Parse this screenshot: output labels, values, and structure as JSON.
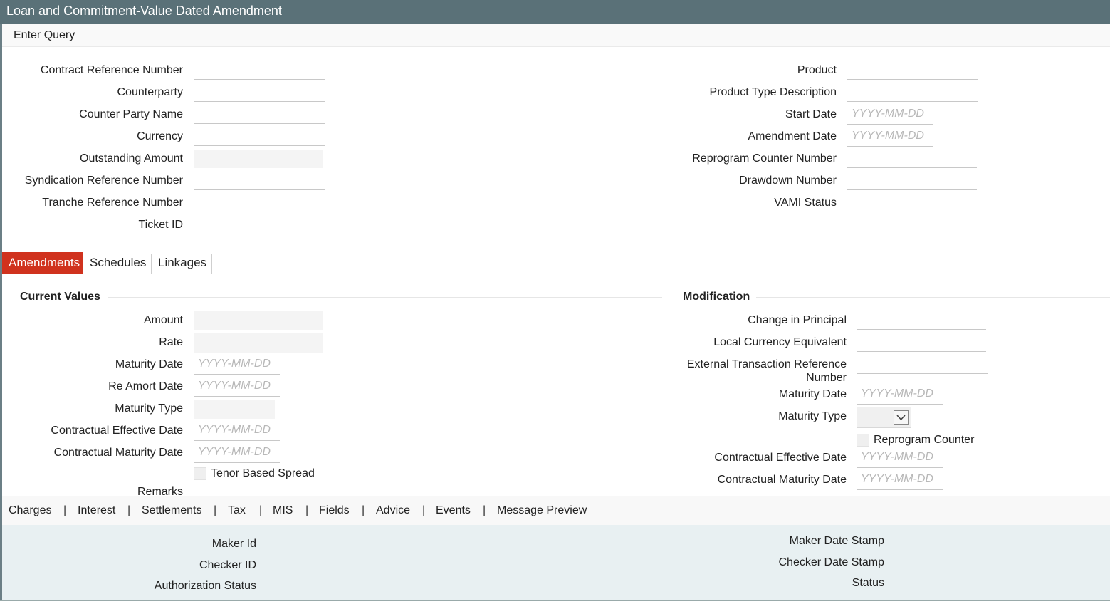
{
  "window": {
    "title": "Loan and Commitment-Value Dated Amendment"
  },
  "toolbar": {
    "enter_query": "Enter Query"
  },
  "header_left": {
    "contract_reference_number": "Contract Reference Number",
    "counterparty": "Counterparty",
    "counter_party_name": "Counter Party Name",
    "currency": "Currency",
    "outstanding_amount": "Outstanding Amount",
    "syndication_reference_number": "Syndication Reference Number",
    "tranche_reference_number": "Tranche Reference Number",
    "ticket_id": "Ticket ID"
  },
  "header_right": {
    "product": "Product",
    "product_type_description": "Product Type Description",
    "start_date": "Start Date",
    "amendment_date": "Amendment Date",
    "reprogram_counter_number": "Reprogram Counter Number",
    "drawdown_number": "Drawdown Number",
    "vami_status": "VAMI Status"
  },
  "date_placeholder": "YYYY-MM-DD",
  "tabs": [
    "Amendments",
    "Schedules",
    "Linkages"
  ],
  "current_values": {
    "title": "Current Values",
    "amount": "Amount",
    "rate": "Rate",
    "maturity_date": "Maturity Date",
    "re_amort_date": "Re Amort Date",
    "maturity_type": "Maturity Type",
    "contractual_effective_date": "Contractual Effective Date",
    "contractual_maturity_date": "Contractual Maturity Date",
    "tenor_based_spread": "Tenor Based Spread",
    "remarks": "Remarks"
  },
  "modification": {
    "title": "Modification",
    "change_in_principal": "Change in Principal",
    "local_currency_equivalent": "Local Currency Equivalent",
    "external_transaction_reference_line1": "External Transaction Reference",
    "external_transaction_reference_line2": "Number",
    "maturity_date": "Maturity Date",
    "maturity_type": "Maturity Type",
    "reprogram_counter": "Reprogram Counter",
    "contractual_effective_date": "Contractual Effective Date",
    "contractual_maturity_date": "Contractual Maturity Date"
  },
  "links": [
    "Charges",
    "Interest",
    "Settlements",
    "Tax",
    "MIS",
    "Fields",
    "Advice",
    "Events",
    "Message Preview"
  ],
  "link_separator": "|",
  "footer": {
    "maker_id": "Maker Id",
    "checker_id": "Checker ID",
    "authorization_status": "Authorization Status",
    "maker_date_stamp": "Maker Date Stamp",
    "checker_date_stamp": "Checker Date Stamp",
    "status": "Status"
  },
  "colors": {
    "titlebar": "#5a7178",
    "active_tab": "#d0321e",
    "footer_bg": "#e8f0f2"
  },
  "icons": {
    "maturity_type_dropdown": "chevron-down-icon"
  }
}
